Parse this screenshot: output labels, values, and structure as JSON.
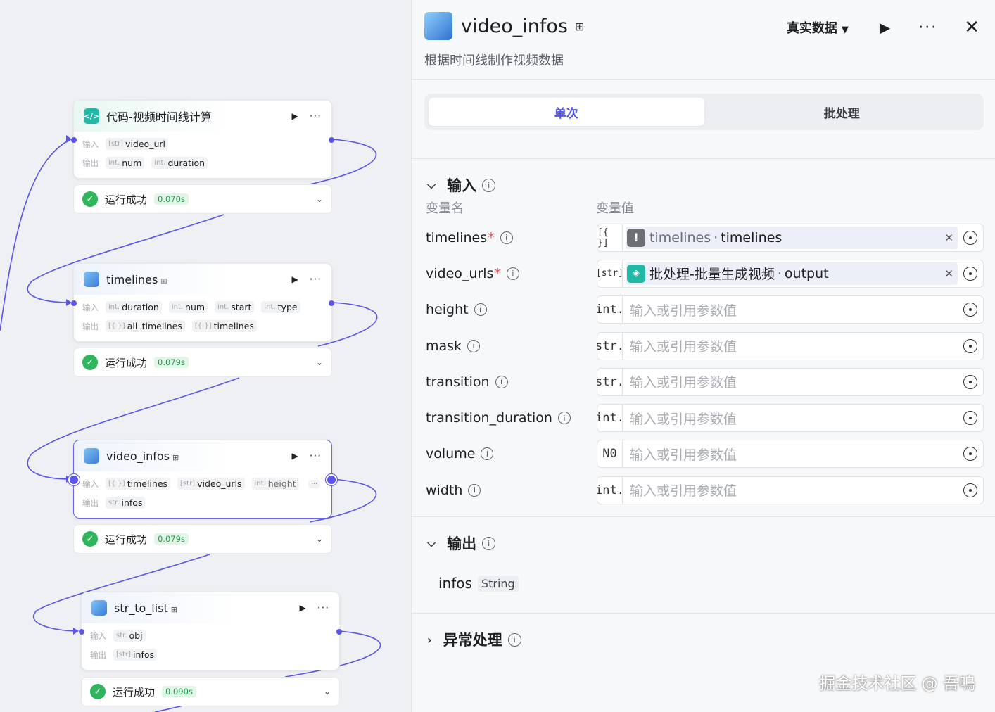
{
  "canvas": {
    "nodes": [
      {
        "title": "代码-视频时间线计算",
        "tag": "",
        "input_label": "输入",
        "output_label": "输出",
        "inputs": [
          {
            "type": "[str]",
            "name": "video_url"
          }
        ],
        "outputs": [
          {
            "type": "int.",
            "name": "num"
          },
          {
            "type": "int.",
            "name": "duration"
          }
        ],
        "status": "运行成功",
        "time": "0.070s"
      },
      {
        "title": "timelines",
        "tag": "⊞",
        "input_label": "输入",
        "output_label": "输出",
        "inputs": [
          {
            "type": "int.",
            "name": "duration"
          },
          {
            "type": "int.",
            "name": "num"
          },
          {
            "type": "int.",
            "name": "start"
          },
          {
            "type": "int.",
            "name": "type"
          }
        ],
        "outputs": [
          {
            "type": "[{ }]",
            "name": "all_timelines"
          },
          {
            "type": "[{ }]",
            "name": "timelines"
          }
        ],
        "status": "运行成功",
        "time": "0.079s"
      },
      {
        "title": "video_infos",
        "tag": "⊞",
        "input_label": "输入",
        "output_label": "输出",
        "inputs": [
          {
            "type": "[{ }]",
            "name": "timelines"
          },
          {
            "type": "[str]",
            "name": "video_urls"
          },
          {
            "type": "int.",
            "name": "height"
          }
        ],
        "outputs": [
          {
            "type": "str.",
            "name": "infos"
          }
        ],
        "status": "运行成功",
        "time": "0.079s"
      },
      {
        "title": "str_to_list",
        "tag": "⊞",
        "input_label": "输入",
        "output_label": "输出",
        "inputs": [
          {
            "type": "str.",
            "name": "obj"
          }
        ],
        "outputs": [
          {
            "type": "[str]",
            "name": "infos"
          }
        ],
        "status": "运行成功",
        "time": "0.090s"
      }
    ]
  },
  "panel": {
    "title": "video_infos",
    "title_tag": "⊞",
    "description": "根据时间线制作视频数据",
    "data_mode": "真实数据",
    "tabs": [
      "单次",
      "批处理"
    ],
    "input_section": {
      "title": "输入",
      "col_name": "变量名",
      "col_value": "变量值",
      "params": [
        {
          "name": "timelines",
          "required": true,
          "type": "[{ }]",
          "ref": {
            "source": "timelines",
            "target": "timelines",
            "icon": "warning-icon"
          }
        },
        {
          "name": "video_urls",
          "required": true,
          "type": "[str]",
          "ref": {
            "source": "批处理-批量生成视频",
            "target": "output",
            "icon": "batch-icon"
          }
        },
        {
          "name": "height",
          "required": false,
          "type": "int.",
          "placeholder": "输入或引用参数值"
        },
        {
          "name": "mask",
          "required": false,
          "type": "str.",
          "placeholder": "输入或引用参数值"
        },
        {
          "name": "transition",
          "required": false,
          "type": "str.",
          "placeholder": "输入或引用参数值"
        },
        {
          "name": "transition_duration",
          "required": false,
          "type": "int.",
          "placeholder": "输入或引用参数值"
        },
        {
          "name": "volume",
          "required": false,
          "type": "N0",
          "placeholder": "输入或引用参数值"
        },
        {
          "name": "width",
          "required": false,
          "type": "int.",
          "placeholder": "输入或引用参数值"
        }
      ]
    },
    "output_section": {
      "title": "输出",
      "outputs": [
        {
          "name": "infos",
          "type": "String"
        }
      ]
    },
    "error_section": {
      "title": "异常处理"
    }
  },
  "watermark": "掘金技术社区 @ 吾鳴"
}
